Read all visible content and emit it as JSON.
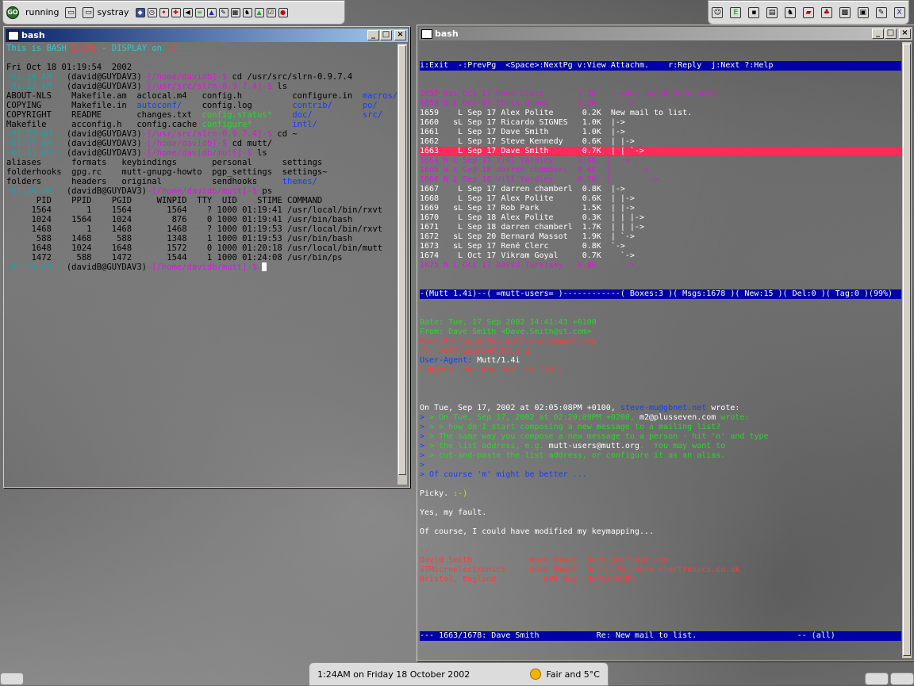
{
  "panel_left": {
    "go_label": "GO",
    "running": "running",
    "systray": "systray"
  },
  "panel_right": {
    "icons": [
      "user-icon",
      "chip-icon",
      "terminal-icon",
      "document-icon",
      "gnu-icon",
      "book-icon",
      "game-icon",
      "grid-icon",
      "image-icon",
      "edit-icon",
      "x-icon"
    ]
  },
  "left_window": {
    "title": "bash",
    "lines": [
      [
        [
          "c-cyan",
          "This is BASH "
        ],
        [
          "c-red",
          "2.05b"
        ],
        [
          "c-cyan",
          " - DISPLAY on "
        ],
        [
          "c-red",
          ":0"
        ]
      ],
      [
        [
          "c-black",
          ""
        ]
      ],
      [
        [
          "c-black",
          "Fri Oct 18 01:19:54  2002"
        ]
      ],
      [
        [
          "c-dim",
          "-01:19 AM - "
        ],
        [
          "c-black",
          "(david@GUYDAV3)"
        ],
        [
          "c-magenta",
          "-[/home/davidb]-$ "
        ],
        [
          "c-black",
          "cd /usr/src/slrn-0.9.7.4"
        ]
      ],
      [
        [
          "c-dim",
          "-01:23 AM - "
        ],
        [
          "c-black",
          "(david@GUYDAV3)"
        ],
        [
          "c-magenta",
          "-[/usr/src/slrn-0.9.7.4]-$ "
        ],
        [
          "c-black",
          "ls"
        ]
      ],
      [
        [
          "c-black",
          "ABOUT-NLS    Makefile.am  aclocal.m4   config.h          configure.in  "
        ],
        [
          "c-blue",
          "macros/"
        ]
      ],
      [
        [
          "c-black",
          "COPYING      Makefile.in  "
        ],
        [
          "c-blue",
          "autoconf/"
        ],
        [
          "c-black",
          "    config.log        "
        ],
        [
          "c-blue",
          "contrib/"
        ],
        [
          "c-black",
          "      "
        ],
        [
          "c-blue",
          "po/"
        ]
      ],
      [
        [
          "c-black",
          "COPYRIGHT    README       changes.txt  "
        ],
        [
          "c-green",
          "config.status*"
        ],
        [
          "c-black",
          "    "
        ],
        [
          "c-blue",
          "doc/"
        ],
        [
          "c-black",
          "          "
        ],
        [
          "c-blue",
          "src/"
        ]
      ],
      [
        [
          "c-black",
          "Makefile     acconfig.h   config.cache "
        ],
        [
          "c-green",
          "configure*"
        ],
        [
          "c-black",
          "        "
        ],
        [
          "c-blue",
          "intl/"
        ]
      ],
      [
        [
          "c-dim",
          "-01:23 AM - "
        ],
        [
          "c-black",
          "(david@GUYDAV3)"
        ],
        [
          "c-magenta",
          "-[/usr/src/slrn-0.9.7.4]-$ "
        ],
        [
          "c-black",
          "cd ~"
        ]
      ],
      [
        [
          "c-dim",
          "-01:23 AM - "
        ],
        [
          "c-black",
          "(david@GUYDAV3)"
        ],
        [
          "c-magenta",
          "-[/home/davidb]-$ "
        ],
        [
          "c-black",
          "cd mutt/"
        ]
      ],
      [
        [
          "c-dim",
          "-01:23 AM - "
        ],
        [
          "c-black",
          "(david@GUYDAV3)"
        ],
        [
          "c-magenta",
          "-[/home/davidb/mutt]-$ "
        ],
        [
          "c-black",
          "ls"
        ]
      ],
      [
        [
          "c-black",
          "aliases      formats   keybindings       personal      settings"
        ]
      ],
      [
        [
          "c-black",
          "folderhooks  gpg.rc    mutt-gnupg-howto  pgp_settings  settings~"
        ]
      ],
      [
        [
          "c-black",
          "folders      headers   original          sendhooks     "
        ],
        [
          "c-blue",
          "themes/"
        ]
      ],
      [
        [
          "c-dim",
          "-01:24 AM - "
        ],
        [
          "c-black",
          "(davidB@GUYDAV3)"
        ],
        [
          "c-magenta",
          "-[/home/davidb/mutt]-$ "
        ],
        [
          "c-black",
          "ps"
        ]
      ],
      [
        [
          "c-black",
          "      PID    PPID    PGID     WINPID  TTY  UID    STIME COMMAND"
        ]
      ],
      [
        [
          "c-black",
          "     1564       1    1564       1564    ? 1000 01:19:41 /usr/local/bin/rxvt"
        ]
      ],
      [
        [
          "c-black",
          "     1024    1564    1024        876    0 1000 01:19:41 /usr/bin/bash"
        ]
      ],
      [
        [
          "c-black",
          "     1468       1    1468       1468    ? 1000 01:19:53 /usr/local/bin/rxvt"
        ]
      ],
      [
        [
          "c-black",
          "      588    1468     588       1348    1 1000 01:19:53 /usr/bin/bash"
        ]
      ],
      [
        [
          "c-black",
          "     1648    1024    1648       1572    0 1000 01:20:18 /usr/local/bin/mutt"
        ]
      ],
      [
        [
          "c-black",
          "     1472     588    1472       1544    1 1000 01:24:08 /usr/bin/ps"
        ]
      ],
      [
        [
          "c-dim",
          "-01:24 AM - "
        ],
        [
          "c-black",
          "(davidB@GUYDAV3)"
        ],
        [
          "c-magenta",
          "-[/home/davidb/mutt]-$ "
        ]
      ]
    ]
  },
  "right_window": {
    "title": "bash",
    "help_bar": "i:Exit  -:PrevPg  <Space>:NextPg v:View Attachm.    r:Reply  j:Next ?:Help",
    "index": [
      {
        "cls": "c-magenta",
        "text": "1657 NsL Oct 17 René Clerc       1.2K   `->Re: batch mode mutt"
      },
      {
        "cls": "c-magenta",
        "text": "1658 N L Oct 17 Chris Green      1.2K     `->"
      },
      {
        "cls": "c-white",
        "text": "1659    L Sep 17 Alex Polite      0.2K  New mail to list."
      },
      {
        "cls": "c-white",
        "text": "1660   sL Sep 17 Ricardo SIGNES   1.0K  |->"
      },
      {
        "cls": "c-white",
        "text": "1661    L Sep 17 Dave Smith       1.0K  |->"
      },
      {
        "cls": "c-white",
        "text": "1662    L Sep 17 Steve Kennedy    0.6K  | |->"
      },
      {
        "cls": "sel",
        "text": "1663    L Sep 17 Dave Smith       0.7K  | | `->"
      },
      {
        "cls": "c-magenta",
        "text": "1664 N L Sep 17 Vill Yardley     1.4K  | `->"
      },
      {
        "cls": "c-magenta",
        "text": "1665 N L Sep 18 darren chamberl  0.6K  |     `->"
      },
      {
        "cls": "c-magenta",
        "text": "1666 N L Sep 18 Vill Yardley     0.7K  |       `->"
      },
      {
        "cls": "c-white",
        "text": "1667    L Sep 17 darren chamberl  0.8K  |->"
      },
      {
        "cls": "c-white",
        "text": "1668    L Sep 17 Alex Polite      0.6K  | |->"
      },
      {
        "cls": "c-white",
        "text": "1669   sL Sep 17 Rob Park         1.5K  | |->"
      },
      {
        "cls": "c-white",
        "text": "1670    L Sep 18 Alex Polite      0.3K  | | |->"
      },
      {
        "cls": "c-white",
        "text": "1671    L Sep 18 darren chamberl  1.7K  | | |->"
      },
      {
        "cls": "c-white",
        "text": "1672   sL Sep 20 Bernard Massot   1.9K  | `->"
      },
      {
        "cls": "c-white",
        "text": "1673   sL Sep 17 René Clerc       0.8K  `->"
      },
      {
        "cls": "c-white",
        "text": "1674    L Oct 17 Vikram Goyal     0.7K    `->"
      },
      {
        "cls": "c-magenta",
        "text": "1675 N L Oct 17 David Turetsky   0.8K     `->"
      }
    ],
    "status_bar": "-(Mutt 1.4i)--( =mutt-users= )------------( Boxes:3 )( Msgs:1678 )( New:15 )( Del:0 )( Tag:0 )(99%)",
    "headers": [
      [
        [
          "c-green",
          "Date: Tue, 17 Sep 2002 14:41:43 +0100"
        ]
      ],
      [
        [
          "c-green",
          "From: Dave Smith <Dave.Smith@st.com>"
        ]
      ],
      [
        [
          "c-red",
          "Mail-Followup-To: mutt-users@mutt.org"
        ]
      ],
      [
        [
          "c-red",
          "To: mutt-users@mutt.org"
        ]
      ],
      [
        [
          "c-blue",
          "User-Agent: "
        ],
        [
          "c-white",
          "Mutt/1.4i"
        ]
      ],
      [
        [
          "c-red",
          "Subject: Re: New mail to list."
        ]
      ]
    ],
    "body": [
      [
        [
          "c-white",
          ""
        ]
      ],
      [
        [
          "c-white",
          "On Tue, Sep 17, 2002 at 02:05:08PM +0100, "
        ],
        [
          "c-blue",
          "steve-mu@gbnet.net"
        ],
        [
          "c-white",
          " wrote:"
        ]
      ],
      [
        [
          "c-blue",
          "> "
        ],
        [
          "c-green",
          "> On Tue, Sep 17, 2002 at 02:20:09PM +0200, "
        ],
        [
          "c-white",
          "m2@plusseven.com"
        ],
        [
          "c-green",
          " wrote:"
        ]
      ],
      [
        [
          "c-blue",
          "> "
        ],
        [
          "c-green",
          "> > how do I start composing a new message to a mailing list?"
        ]
      ],
      [
        [
          "c-blue",
          "> "
        ],
        [
          "c-green",
          "> The same way you compose a new message to a person - hit 'n' and type"
        ]
      ],
      [
        [
          "c-blue",
          "> "
        ],
        [
          "c-green",
          "> the list address, e.g. "
        ],
        [
          "c-white",
          "mutt-users@mutt.org"
        ],
        [
          "c-green",
          ".  You may want to"
        ]
      ],
      [
        [
          "c-blue",
          "> "
        ],
        [
          "c-green",
          "> cut-and-paste the list address, or configure it as an alias."
        ]
      ],
      [
        [
          "c-blue",
          ">"
        ]
      ],
      [
        [
          "c-blue",
          "> Of course 'm' might be better ..."
        ]
      ],
      [
        [
          "c-white",
          ""
        ]
      ],
      [
        [
          "c-white",
          "Picky. "
        ],
        [
          "c-yellow",
          ":-)"
        ]
      ],
      [
        [
          "c-white",
          ""
        ]
      ],
      [
        [
          "c-white",
          "Yes, my fault."
        ]
      ],
      [
        [
          "c-white",
          ""
        ]
      ],
      [
        [
          "c-white",
          "Of course, I could have modified my keymapping..."
        ]
      ],
      [
        [
          "c-white",
          ""
        ]
      ],
      [
        [
          "c-red",
          "-- "
        ]
      ],
      [
        [
          "c-red",
          "David Smith            Work Email: Dave.Smith@st.com"
        ]
      ],
      [
        [
          "c-red",
          "STMicroelectronics     Home Email: David.Smith@ds-electronics.co.uk"
        ]
      ],
      [
        [
          "c-red",
          "Bristol, England          GPG Key: 0xF13192F2"
        ]
      ]
    ],
    "pager_bar": "--- 1663/1678: Dave Smith            Re: New mail to list.                     -- (all)"
  },
  "clock": {
    "time_text": "1:24AM on Friday 18 October 2002",
    "weather": "Fair and 5°C"
  }
}
